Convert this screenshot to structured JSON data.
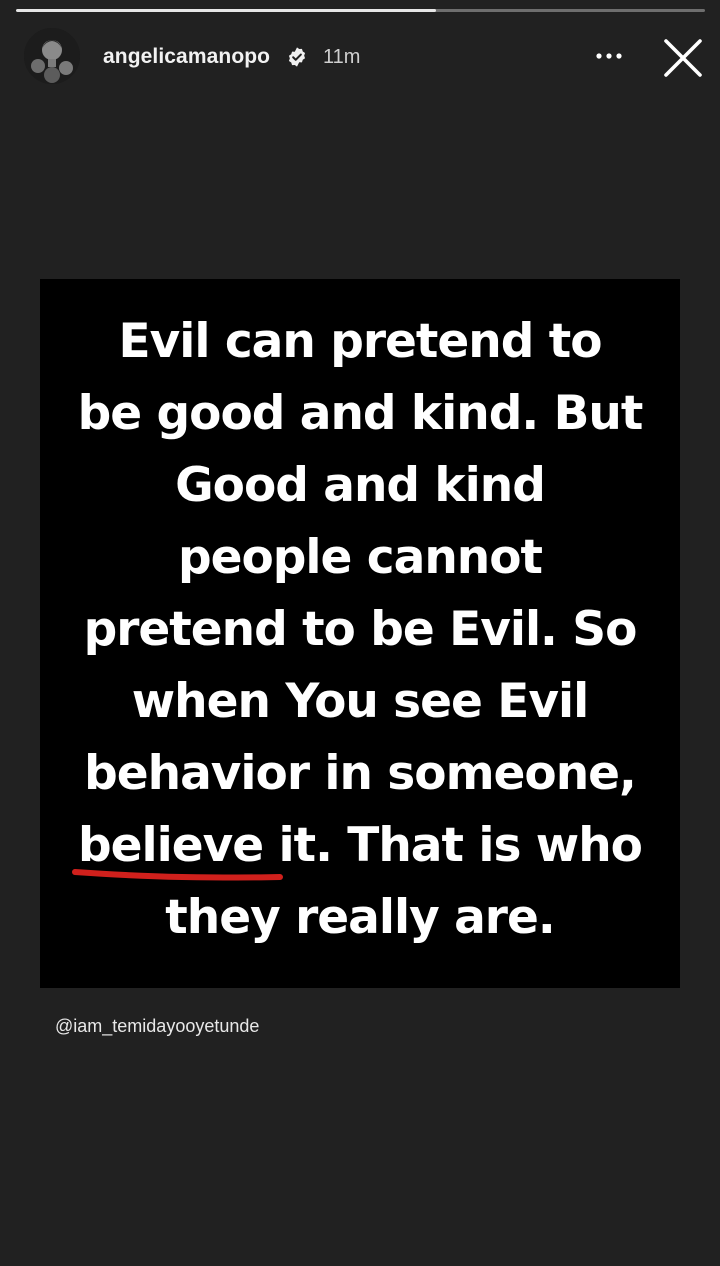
{
  "story": {
    "progress": 0.61
  },
  "header": {
    "username": "angelicamanopo",
    "timestamp": "11m",
    "icons": {
      "avatar": "avatar",
      "verified": "verified-badge-icon",
      "more": "more-options-icon",
      "close": "close-icon"
    }
  },
  "post": {
    "quote_lines": [
      "Evil can pretend to",
      "be good and kind. But",
      "Good and kind",
      "people cannot",
      "pretend to be Evil. So",
      "when You see Evil",
      "behavior in someone,",
      "believe it. That is who",
      "they really are."
    ],
    "underline_color": "#d0201c",
    "credit": "@iam_temidayooyetunde"
  },
  "colors": {
    "background": "#212121",
    "card": "#000000",
    "text": "#ffffff"
  }
}
